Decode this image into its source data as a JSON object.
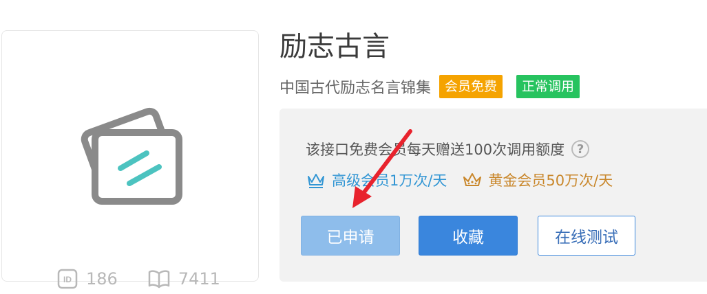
{
  "card": {
    "id_value": "186",
    "views_value": "7411",
    "icons": [
      "card-stack-icon",
      "id-icon",
      "book-icon"
    ]
  },
  "header": {
    "title": "励志古言",
    "subtitle": "中国古代励志名言锦集",
    "tags": {
      "free": "会员免费",
      "normal": "正常调用"
    }
  },
  "panel": {
    "description": "该接口免费会员每天赠送100次调用额度",
    "help": "?",
    "tiers": {
      "senior": "高级会员1万次/天",
      "gold": "黄金会员50万次/天"
    },
    "buttons": {
      "applied": "已申请",
      "collect": "收藏",
      "test": "在线测试"
    }
  },
  "colors": {
    "tag_free": "#f5a300",
    "tag_normal": "#27c35f",
    "primary": "#3a86dd",
    "disabled": "#8ebdeb",
    "senior": "#3296d4",
    "gold": "#c9872b",
    "arrow": "#e8232d"
  }
}
